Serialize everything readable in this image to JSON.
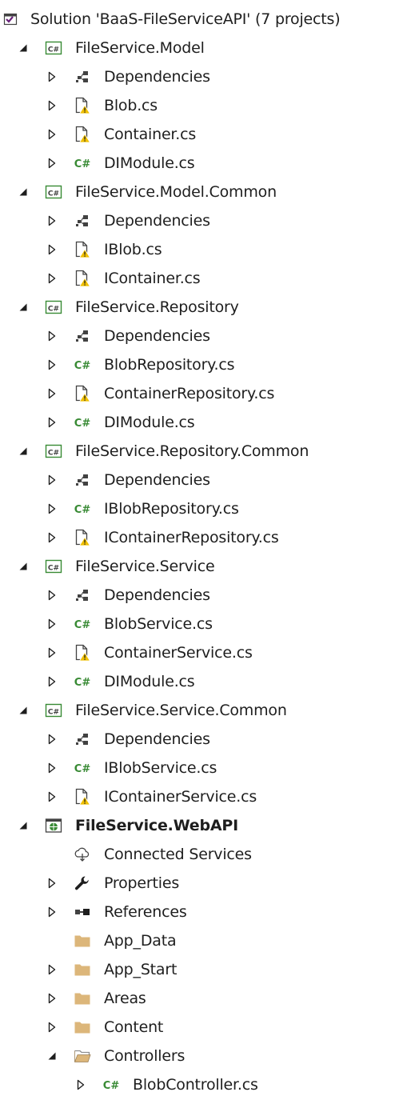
{
  "solution_explorer": {
    "colors": {
      "text": "#1e1e1e",
      "csharp": "#388a34",
      "warning": "#f0c000",
      "folder": "#dcb67a",
      "project_border": "#388a34",
      "vs_purple": "#68217a"
    },
    "items": [
      {
        "label": "Solution 'BaaS-FileServiceAPI' (7 projects)",
        "level": 0,
        "expander": "none",
        "icon": "solution-icon",
        "bold": false
      },
      {
        "label": "FileService.Model",
        "level": 1,
        "expander": "expanded",
        "icon": "csharp-project-icon",
        "bold": false
      },
      {
        "label": "Dependencies",
        "level": 2,
        "expander": "collapsed",
        "icon": "dependencies-icon",
        "bold": false
      },
      {
        "label": "Blob.cs",
        "level": 2,
        "expander": "collapsed",
        "icon": "file-warning-icon",
        "bold": false
      },
      {
        "label": "Container.cs",
        "level": 2,
        "expander": "collapsed",
        "icon": "file-warning-icon",
        "bold": false
      },
      {
        "label": "DIModule.cs",
        "level": 2,
        "expander": "collapsed",
        "icon": "csharp-file-icon",
        "bold": false
      },
      {
        "label": "FileService.Model.Common",
        "level": 1,
        "expander": "expanded",
        "icon": "csharp-project-icon",
        "bold": false
      },
      {
        "label": "Dependencies",
        "level": 2,
        "expander": "collapsed",
        "icon": "dependencies-icon",
        "bold": false
      },
      {
        "label": "IBlob.cs",
        "level": 2,
        "expander": "collapsed",
        "icon": "file-warning-icon",
        "bold": false
      },
      {
        "label": "IContainer.cs",
        "level": 2,
        "expander": "collapsed",
        "icon": "file-warning-icon",
        "bold": false
      },
      {
        "label": "FileService.Repository",
        "level": 1,
        "expander": "expanded",
        "icon": "csharp-project-icon",
        "bold": false
      },
      {
        "label": "Dependencies",
        "level": 2,
        "expander": "collapsed",
        "icon": "dependencies-icon",
        "bold": false
      },
      {
        "label": "BlobRepository.cs",
        "level": 2,
        "expander": "collapsed",
        "icon": "csharp-file-icon",
        "bold": false
      },
      {
        "label": "ContainerRepository.cs",
        "level": 2,
        "expander": "collapsed",
        "icon": "file-warning-icon",
        "bold": false
      },
      {
        "label": "DIModule.cs",
        "level": 2,
        "expander": "collapsed",
        "icon": "csharp-file-icon",
        "bold": false
      },
      {
        "label": "FileService.Repository.Common",
        "level": 1,
        "expander": "expanded",
        "icon": "csharp-project-icon",
        "bold": false
      },
      {
        "label": "Dependencies",
        "level": 2,
        "expander": "collapsed",
        "icon": "dependencies-icon",
        "bold": false
      },
      {
        "label": "IBlobRepository.cs",
        "level": 2,
        "expander": "collapsed",
        "icon": "csharp-file-icon",
        "bold": false
      },
      {
        "label": "IContainerRepository.cs",
        "level": 2,
        "expander": "collapsed",
        "icon": "file-warning-icon",
        "bold": false
      },
      {
        "label": "FileService.Service",
        "level": 1,
        "expander": "expanded",
        "icon": "csharp-project-icon",
        "bold": false
      },
      {
        "label": "Dependencies",
        "level": 2,
        "expander": "collapsed",
        "icon": "dependencies-icon",
        "bold": false
      },
      {
        "label": "BlobService.cs",
        "level": 2,
        "expander": "collapsed",
        "icon": "csharp-file-icon",
        "bold": false
      },
      {
        "label": "ContainerService.cs",
        "level": 2,
        "expander": "collapsed",
        "icon": "file-warning-icon",
        "bold": false
      },
      {
        "label": "DIModule.cs",
        "level": 2,
        "expander": "collapsed",
        "icon": "csharp-file-icon",
        "bold": false
      },
      {
        "label": "FileService.Service.Common",
        "level": 1,
        "expander": "expanded",
        "icon": "csharp-project-icon",
        "bold": false
      },
      {
        "label": "Dependencies",
        "level": 2,
        "expander": "collapsed",
        "icon": "dependencies-icon",
        "bold": false
      },
      {
        "label": "IBlobService.cs",
        "level": 2,
        "expander": "collapsed",
        "icon": "csharp-file-icon",
        "bold": false
      },
      {
        "label": "IContainerService.cs",
        "level": 2,
        "expander": "collapsed",
        "icon": "file-warning-icon",
        "bold": false
      },
      {
        "label": "FileService.WebAPI",
        "level": 1,
        "expander": "expanded",
        "icon": "web-project-icon",
        "bold": true
      },
      {
        "label": "Connected Services",
        "level": 2,
        "expander": "none",
        "icon": "connected-services-icon",
        "bold": false
      },
      {
        "label": "Properties",
        "level": 2,
        "expander": "collapsed",
        "icon": "wrench-icon",
        "bold": false
      },
      {
        "label": "References",
        "level": 2,
        "expander": "collapsed",
        "icon": "references-icon",
        "bold": false
      },
      {
        "label": "App_Data",
        "level": 2,
        "expander": "none",
        "icon": "folder-icon",
        "bold": false
      },
      {
        "label": "App_Start",
        "level": 2,
        "expander": "collapsed",
        "icon": "folder-icon",
        "bold": false
      },
      {
        "label": "Areas",
        "level": 2,
        "expander": "collapsed",
        "icon": "folder-icon",
        "bold": false
      },
      {
        "label": "Content",
        "level": 2,
        "expander": "collapsed",
        "icon": "folder-icon",
        "bold": false
      },
      {
        "label": "Controllers",
        "level": 2,
        "expander": "expanded",
        "icon": "folder-open-icon",
        "bold": false
      },
      {
        "label": "BlobController.cs",
        "level": 3,
        "expander": "collapsed",
        "icon": "csharp-file-icon",
        "bold": false
      }
    ]
  }
}
